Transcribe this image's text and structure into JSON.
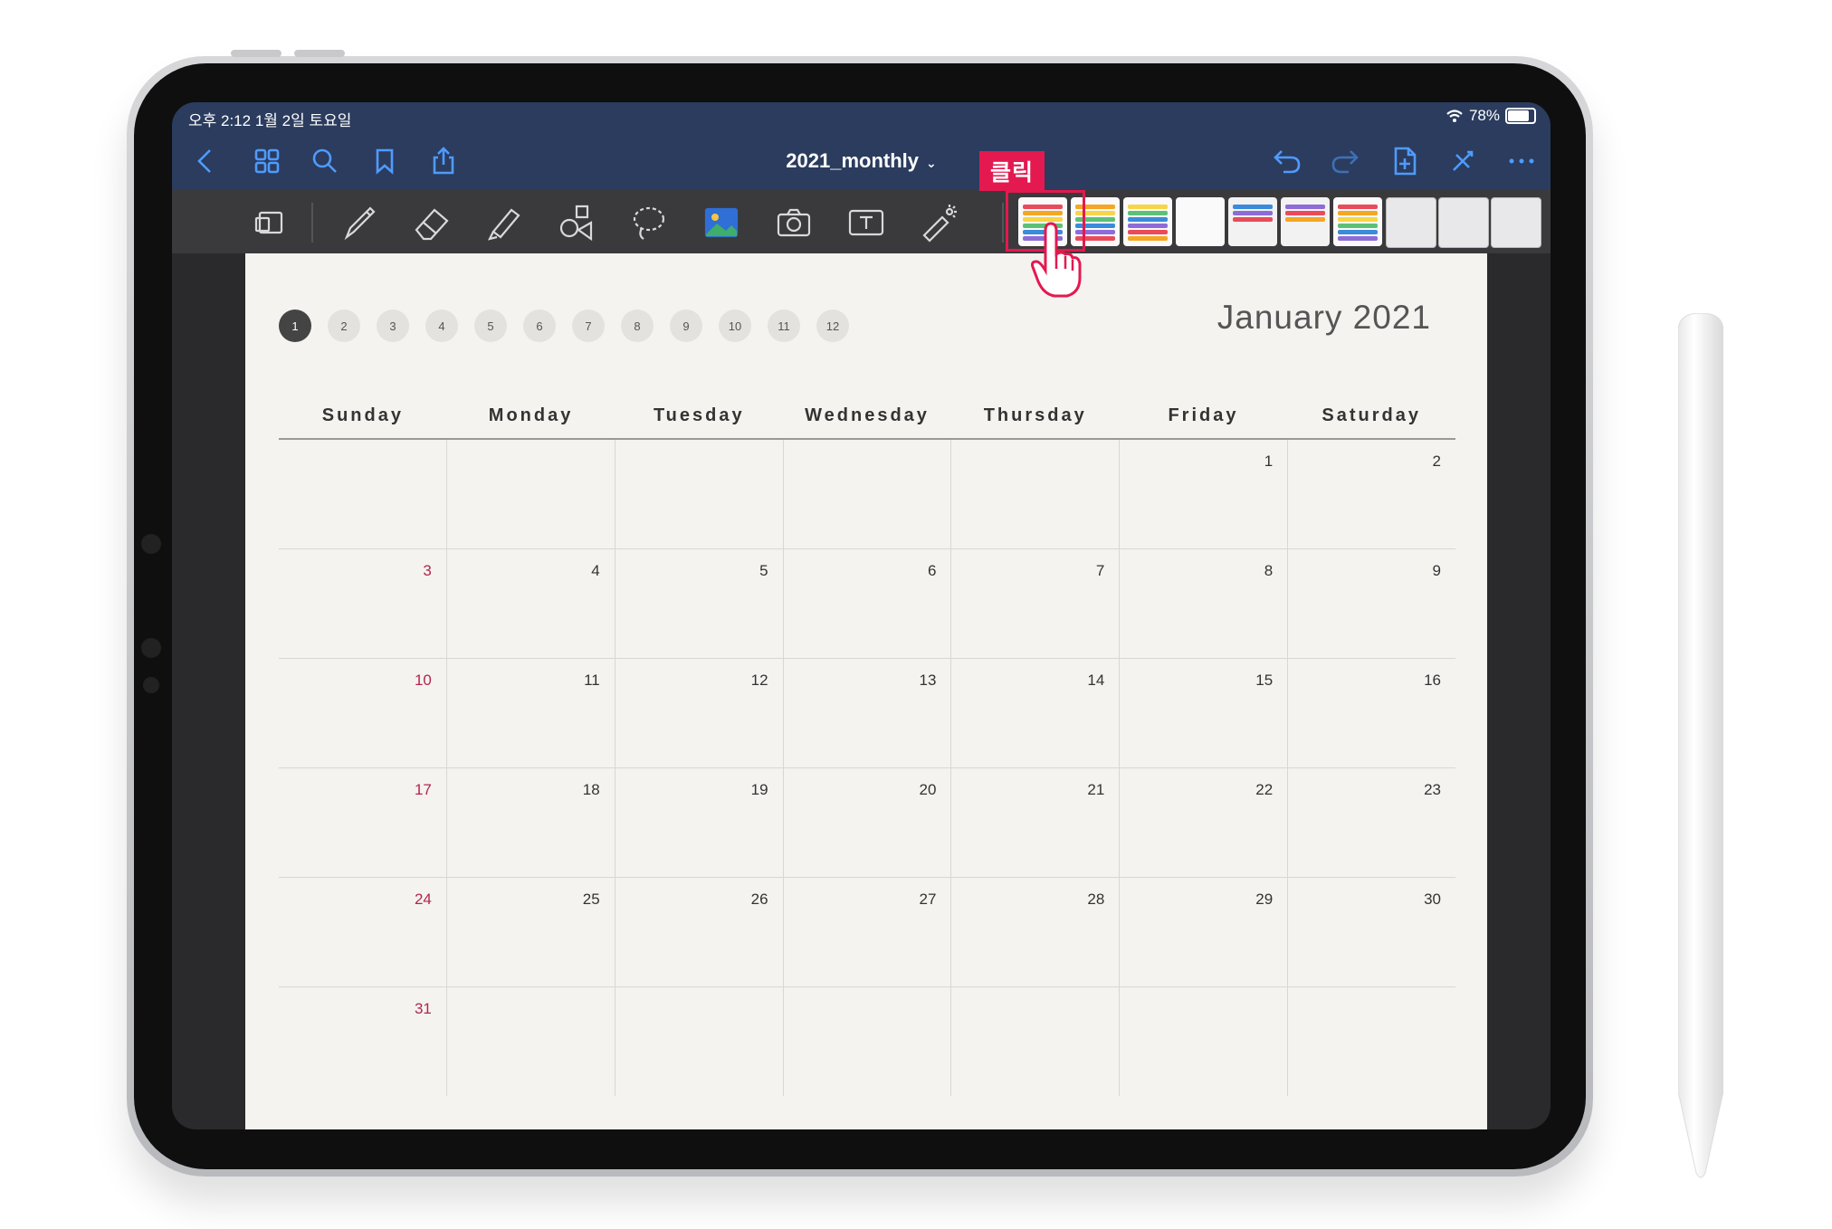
{
  "status_bar": {
    "time": "오후 2:12   1월 2일 토요일",
    "battery": "78%",
    "battery_level": 0.78
  },
  "nav_bar": {
    "title": "2021_monthly",
    "left_icons": [
      "back-chevron-icon",
      "grid-view-icon",
      "search-icon",
      "bookmark-icon",
      "share-icon"
    ],
    "right_icons": [
      "undo-icon",
      "redo-icon",
      "add-page-icon",
      "close-tools-icon",
      "more-icon"
    ],
    "accent_color": "#4f9bff",
    "bar_color": "#2b3c5e"
  },
  "toolbar": {
    "tools": [
      "page-layout-icon",
      "pen-icon",
      "eraser-icon",
      "highlighter-icon",
      "shapes-icon",
      "lasso-icon",
      "image-icon",
      "camera-icon",
      "text-icon",
      "laser-pointer-icon"
    ],
    "sticker_count": 10
  },
  "callout": {
    "label": "클릭",
    "color": "#e3194f"
  },
  "planner": {
    "month_title": "January 2021",
    "months": [
      "1",
      "2",
      "3",
      "4",
      "5",
      "6",
      "7",
      "8",
      "9",
      "10",
      "11",
      "12"
    ],
    "active_month": "1",
    "weekdays": [
      "Sunday",
      "Monday",
      "Tuesday",
      "Wednesday",
      "Thursday",
      "Friday",
      "Saturday"
    ],
    "weeks": [
      [
        "",
        "",
        "",
        "",
        "",
        "1",
        "2"
      ],
      [
        "3",
        "4",
        "5",
        "6",
        "7",
        "8",
        "9"
      ],
      [
        "10",
        "11",
        "12",
        "13",
        "14",
        "15",
        "16"
      ],
      [
        "17",
        "18",
        "19",
        "20",
        "21",
        "22",
        "23"
      ],
      [
        "24",
        "25",
        "26",
        "27",
        "28",
        "29",
        "30"
      ],
      [
        "31",
        "",
        "",
        "",
        "",
        "",
        ""
      ]
    ],
    "sunday_color": "#b3264a"
  }
}
